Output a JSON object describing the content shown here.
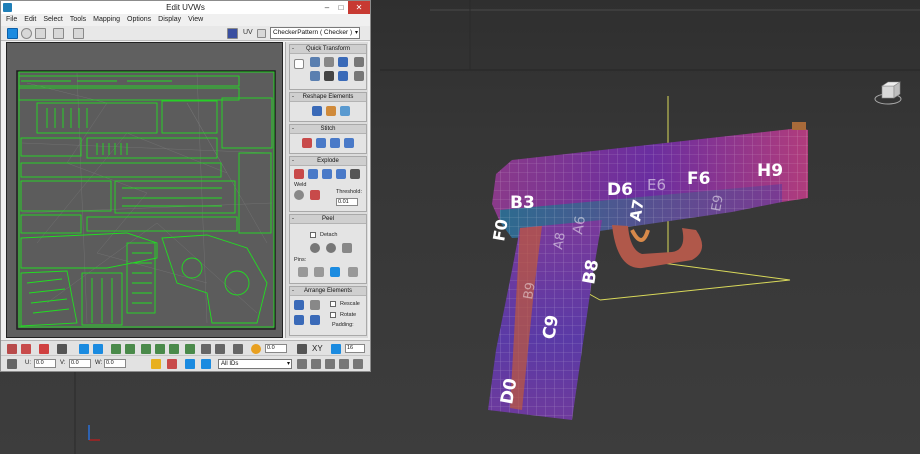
{
  "window": {
    "title": "Edit UVWs",
    "menu": [
      "File",
      "Edit",
      "Select",
      "Tools",
      "Mapping",
      "Options",
      "Display",
      "View"
    ]
  },
  "toolbar": {
    "uv_label": "UV",
    "map_select": "CheckerPattern  ( Checker )"
  },
  "rollouts": {
    "quick_transform": "Quick Transform",
    "reshape_elements": "Reshape Elements",
    "stitch": "Stitch",
    "explode": "Explode",
    "explode_weld_label": "Weld",
    "explode_threshold_label": "Threshold:",
    "explode_threshold_value": "0.01",
    "peel": "Peel",
    "peel_detach_label": "Detach",
    "peel_pins_label": "Pins:",
    "arrange_elements": "Arrange Elements",
    "arrange_rescale_label": "Rescale",
    "arrange_rotate_label": "Rotate",
    "arrange_padding_label": "Padding:",
    "collapse_marker": "-"
  },
  "bottom": {
    "soft_value": "0.0",
    "xy_label": "XY",
    "zoom_value": "16",
    "u_label": "U:",
    "u_value": "0.0",
    "v_label": "V:",
    "v_value": "0.0",
    "w_label": "W:",
    "w_value": "0.0",
    "id_select": "All IDs"
  },
  "viewport": {
    "gun_labels": [
      "B3",
      "D6",
      "E6",
      "F6",
      "H9",
      "F0",
      "A6",
      "A7",
      "A8",
      "B8",
      "C9",
      "D0",
      "B9",
      "E9"
    ]
  },
  "colors": {
    "uv_wire": "#22dd22",
    "select_blue": "#1b8be0",
    "close_red": "#c73a32"
  }
}
